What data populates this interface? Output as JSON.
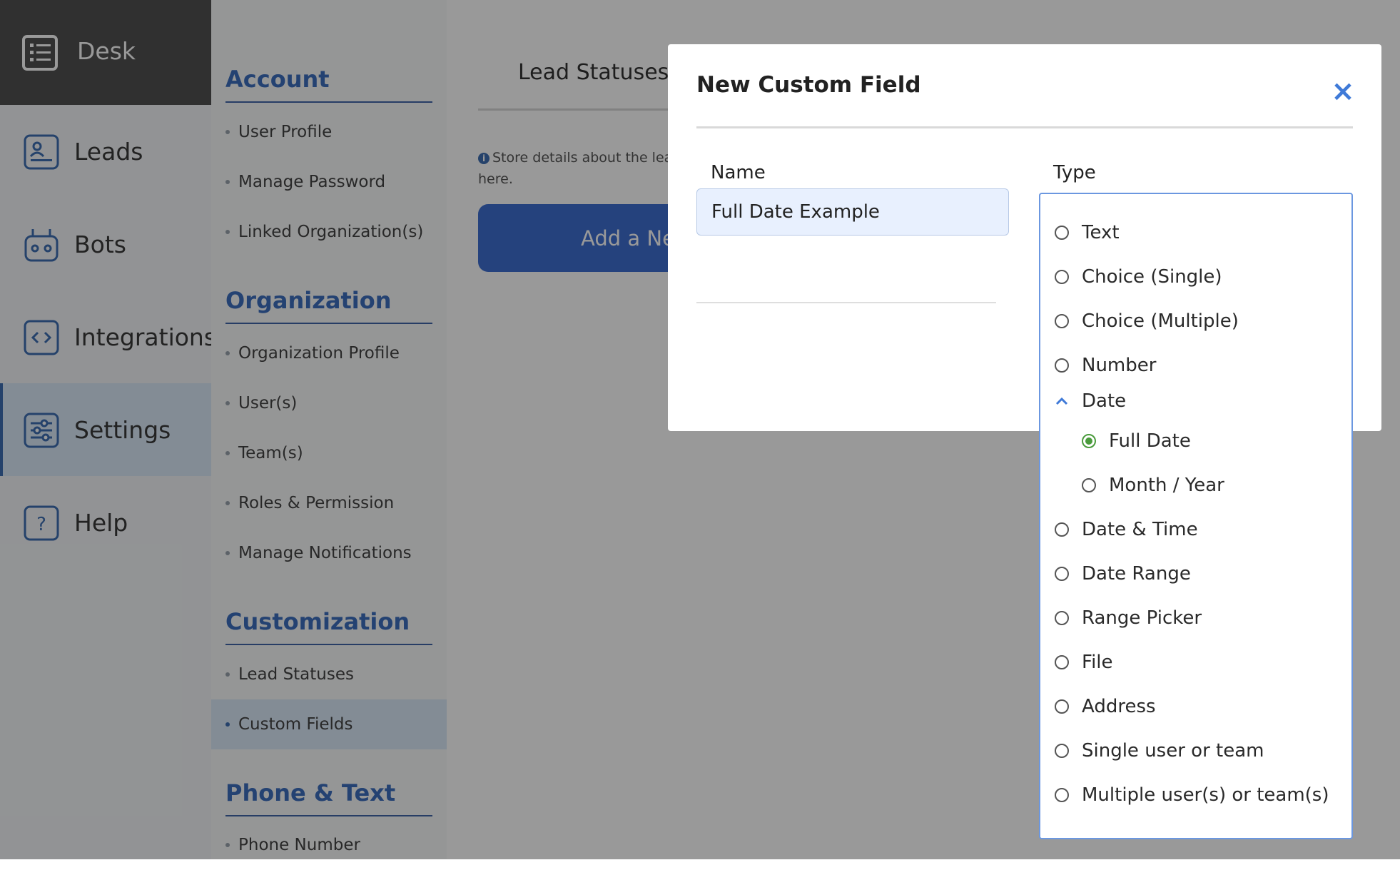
{
  "nav": {
    "brand": "Desk",
    "items": [
      {
        "label": "Leads",
        "icon": "lead-card-icon"
      },
      {
        "label": "Bots",
        "icon": "robot-icon"
      },
      {
        "label": "Integrations",
        "icon": "code-brackets-icon"
      },
      {
        "label": "Settings",
        "icon": "sliders-icon"
      },
      {
        "label": "Help",
        "icon": "help-question-icon"
      }
    ]
  },
  "sidebar": {
    "account": {
      "title": "Account",
      "items": [
        "User Profile",
        "Manage Password",
        "Linked Organization(s)"
      ]
    },
    "organization": {
      "title": "Organization",
      "items": [
        "Organization Profile",
        "User(s)",
        "Team(s)",
        "Roles & Permission",
        "Manage Notifications"
      ]
    },
    "customization": {
      "title": "Customization",
      "items": [
        "Lead Statuses",
        "Custom Fields"
      ]
    },
    "phone": {
      "title": "Phone & Text",
      "items": [
        "Phone Number"
      ]
    }
  },
  "main": {
    "tab": "Lead Statuses",
    "info": "Store details about the lead custom fields here.",
    "add_button": "Add a Ne"
  },
  "modal": {
    "title": "New Custom Field",
    "close_symbol": "×",
    "name_label": "Name",
    "name_value": "Full Date Example",
    "type_label": "Type",
    "types": {
      "text": "Text",
      "choice_single": "Choice (Single)",
      "choice_multiple": "Choice (Multiple)",
      "number": "Number",
      "date": "Date",
      "full_date": "Full Date",
      "month_year": "Month / Year",
      "date_time": "Date & Time",
      "date_range": "Date Range",
      "range_picker": "Range Picker",
      "file": "File",
      "address": "Address",
      "single_user": "Single user or team",
      "multiple_users": "Multiple user(s) or team(s)"
    },
    "selected_type": "Full Date"
  },
  "colors": {
    "accent": "#3f6fb2",
    "selected_radio": "#4a9b3c",
    "close": "#3f7ad8"
  }
}
